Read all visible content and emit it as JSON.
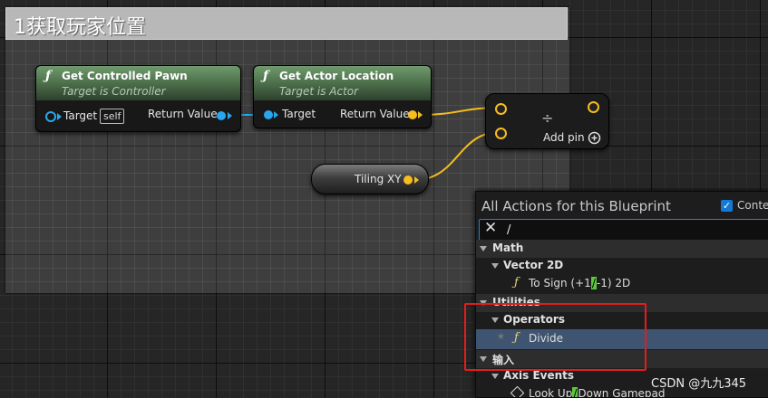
{
  "comment": {
    "title": "1获取玩家位置"
  },
  "nodes": {
    "get_controlled_pawn": {
      "icon": "function-icon",
      "title": "Get Controlled Pawn",
      "subtitle": "Target is Controller",
      "input_label": "Target",
      "input_default": "self",
      "output_label": "Return Value"
    },
    "get_actor_location": {
      "icon": "function-icon",
      "title": "Get Actor Location",
      "subtitle": "Target is Actor",
      "input_label": "Target",
      "output_label": "Return Value"
    },
    "divide": {
      "symbol": "÷",
      "add_pin_label": "Add pin",
      "add_pin_icon": "plus-circle-icon"
    },
    "tiling": {
      "label": "Tiling XY"
    }
  },
  "colors": {
    "object_pin": "#29a7ee",
    "vector_pin": "#f5bd1f",
    "function_header": "#4d6f4b",
    "selection": "#3f5470",
    "highlight": "#5ac83c",
    "annotation": "#e61c1c"
  },
  "action_menu": {
    "title": "All Actions for this Blueprint",
    "context_checkbox": {
      "checked": true,
      "label": "Conte"
    },
    "search": {
      "value": "/",
      "clear_icon": "close-icon"
    },
    "items": {
      "math": "Math",
      "vector2d": "Vector 2D",
      "to_sign": {
        "prefix": "To Sign (+1",
        "match": "/",
        "suffix": "-1) 2D"
      },
      "utilities": "Utilities",
      "operators": "Operators",
      "divide": "Divide",
      "input": "输入",
      "axis_events": "Axis Events",
      "look_up": {
        "prefix": "Look Up",
        "match": "/",
        "suffix": "Down Gamepad"
      }
    }
  },
  "watermark": "CSDN @九九345"
}
